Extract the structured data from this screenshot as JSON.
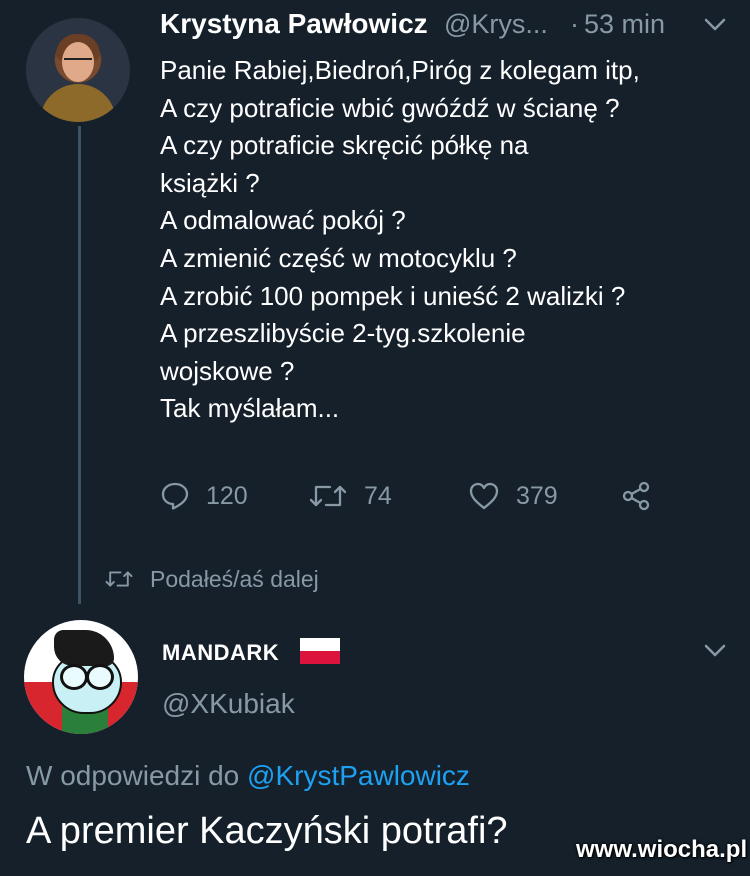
{
  "tweet1": {
    "author_name": "Krystyna Pawłowicz",
    "handle": "@Krys...",
    "separator": "·",
    "time": "53 min",
    "lines": [
      "Panie Rabiej,Biedroń,Piróg z kolegam itp,",
      "A czy potraficie wbić gwóźdź w ścianę ?",
      "A czy potraficie skręcić półkę na",
      "książki ?",
      "A odmalować pokój ?",
      "A zmienić część w motocyklu ?",
      "A zrobić 100 pompek i unieść 2 walizki ?",
      "A przeszlibyście 2-tyg.szkolenie",
      "wojskowe ?",
      "Tak myślałam..."
    ],
    "actions": {
      "reply_count": "120",
      "retweet_count": "74",
      "like_count": "379"
    }
  },
  "retweeted_label": "Podałeś/aś dalej",
  "tweet2": {
    "author_name": "MANDARK",
    "flag": "Poland flag",
    "handle": "@XKubiak",
    "reply_to_label": "W odpowiedzi do",
    "reply_to_handle": "@KrystPawlowicz",
    "text": "A premier Kaczyński potrafi?"
  },
  "watermark": "www.wiocha.pl",
  "icons": {
    "reply": "reply-icon",
    "retweet": "retweet-icon",
    "like": "heart-icon",
    "share": "share-icon",
    "more": "chevron-down-icon"
  },
  "colors": {
    "background": "#15202b",
    "secondary_text": "#8899a6",
    "link": "#1da1f2",
    "thread_line": "#3d5466"
  }
}
